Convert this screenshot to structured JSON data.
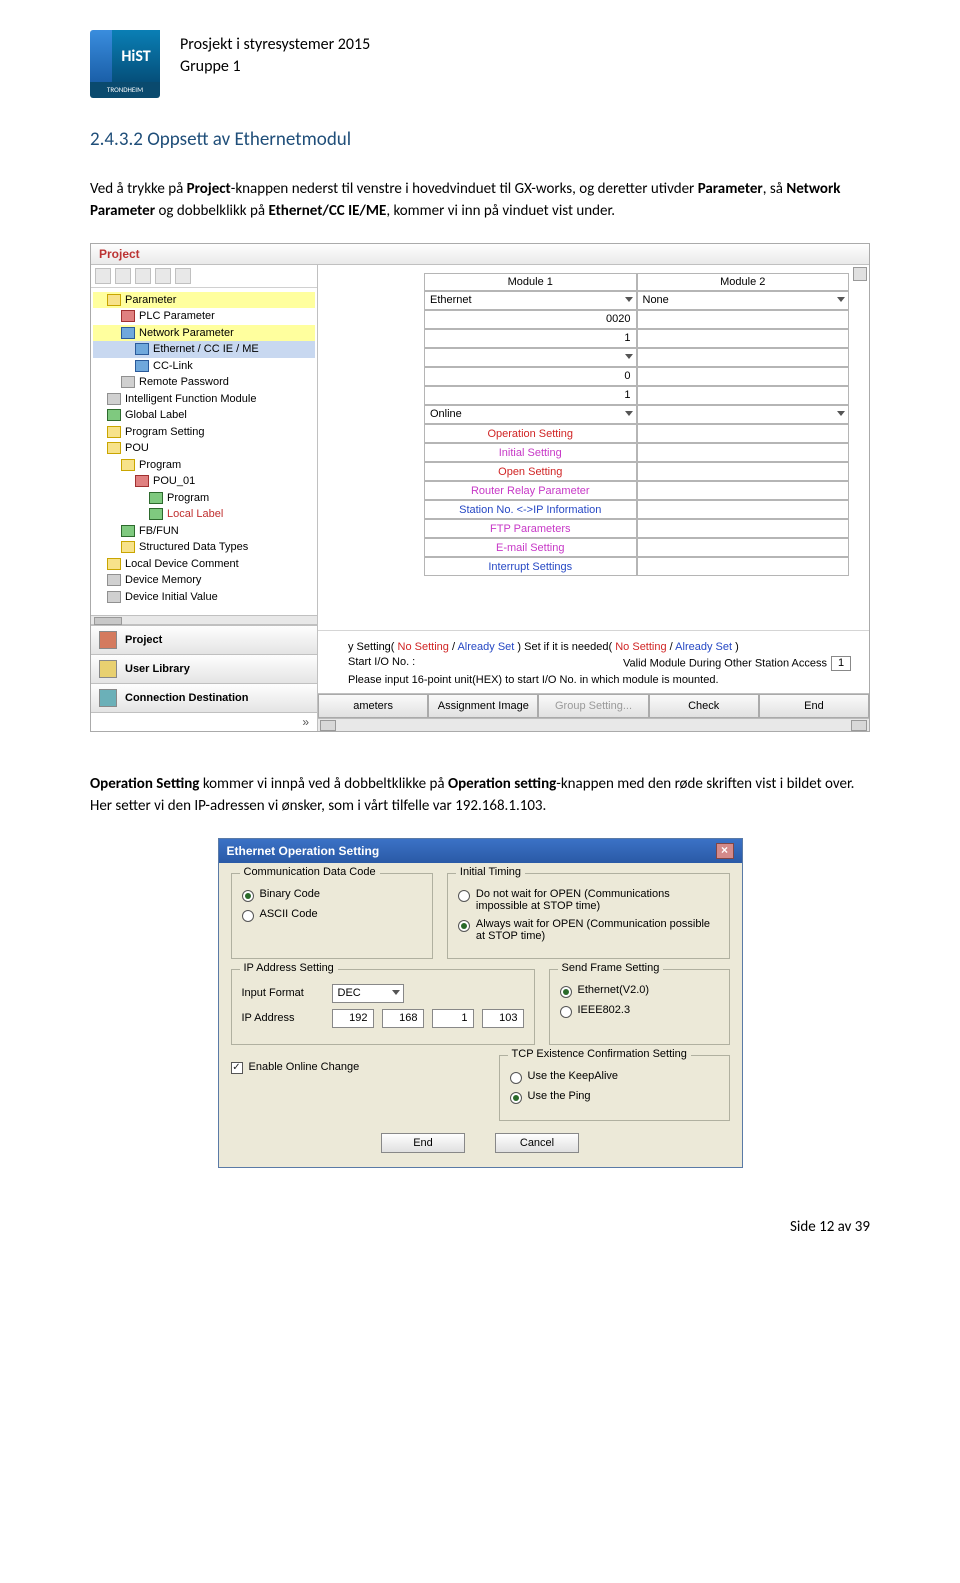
{
  "header": {
    "title_line1": "Prosjekt i styresystemer 2015",
    "title_line2": "Gruppe 1",
    "logo_text": "HiST",
    "logo_sub": "TRONDHEIM"
  },
  "section_heading": "2.4.3.2 Oppsett av Ethernetmodul",
  "para1_pre": "Ved å trykke på ",
  "para1_b1": "Project",
  "para1_mid1": "-knappen nederst til venstre i hovedvinduet til GX-works, og deretter utivder ",
  "para1_b2": "Parameter",
  "para1_mid2": ", så ",
  "para1_b3": "Network Parameter",
  "para1_mid3": " og dobbelklikk på ",
  "para1_b4": "Ethernet/CC IE/ME",
  "para1_mid4": ", kommer vi inn på vinduet vist under.",
  "para2_b1": "Operation Setting",
  "para2_mid1": " kommer vi innpå ved å dobbeltklikke på ",
  "para2_b2": "Operation setting",
  "para2_mid2": "-knappen med den røde skriften vist i bildet over. Her setter vi den IP-adressen vi ønsker, som i vårt tilfelle var 192.168.1.103.",
  "footer_text": "Side 12 av 39",
  "s1": {
    "project_label": "Project",
    "tree": {
      "parameter": "Parameter",
      "plc_parameter": "PLC Parameter",
      "network_parameter": "Network Parameter",
      "ethernet_cc": "Ethernet / CC IE / ME",
      "cc_link": "CC-Link",
      "remote_password": "Remote Password",
      "intelligent_module": "Intelligent Function Module",
      "global_label": "Global Label",
      "program_setting": "Program Setting",
      "pou": "POU",
      "program": "Program",
      "pou01": "POU_01",
      "program2": "Program",
      "local_label": "Local Label",
      "fbfun": "FB/FUN",
      "struct_types": "Structured Data Types",
      "local_dev_comment": "Local Device Comment",
      "device_memory": "Device Memory",
      "device_initial": "Device Initial Value"
    },
    "nav": {
      "project": "Project",
      "user_library": "User Library",
      "conn_dest": "Connection Destination"
    },
    "mod": {
      "h1": "Module 1",
      "h2": "Module 2",
      "ethernet": "Ethernet",
      "none": "None",
      "val_0020": "0020",
      "val_1": "1",
      "val_0": "0",
      "online": "Online"
    },
    "links": {
      "op_setting": "Operation Setting",
      "initial_setting": "Initial Setting",
      "open_setting": "Open Setting",
      "router_relay": "Router Relay Parameter",
      "station_ip": "Station No. <->IP Information",
      "ftp": "FTP Parameters",
      "email": "E-mail Setting",
      "interrupt": "Interrupt Settings"
    },
    "status": {
      "line1_pre": "y Setting( ",
      "no_setting": "No Setting",
      "slash": "  /  ",
      "already_set": "Already Set",
      "line1_post": " )          Set if it is needed( ",
      "line1_end": " )",
      "line2": "Start I/O No. :",
      "line2_right": "Valid Module During Other Station Access",
      "valid_val": "1",
      "line3": "Please input 16-point unit(HEX) to start I/O No. in which module is mounted."
    },
    "buttons": {
      "b1": "ameters",
      "b2": "Assignment Image",
      "b3": "Group Setting...",
      "b4": "Check",
      "b5": "End"
    }
  },
  "s2": {
    "title": "Ethernet Operation Setting",
    "comm_code_label": "Communication Data Code",
    "binary": "Binary Code",
    "ascii": "ASCII Code",
    "initial_timing_label": "Initial Timing",
    "timing_opt1": "Do not wait for OPEN (Communications impossible at STOP time)",
    "timing_opt2": "Always wait for OPEN (Communication possible at STOP time)",
    "ip_setting_label": "IP Address Setting",
    "input_format": "Input Format",
    "dec": "DEC",
    "ip_address_label": "IP Address",
    "ip": {
      "a": "192",
      "b": "168",
      "c": "1",
      "d": "103"
    },
    "send_frame_label": "Send Frame Setting",
    "eth_v2": "Ethernet(V2.0)",
    "ieee": "IEEE802.3",
    "enable_online": "Enable Online Change",
    "tcp_label": "TCP Existence Confirmation Setting",
    "keepalive": "Use the KeepAlive",
    "use_ping": "Use the Ping",
    "btn_end": "End",
    "btn_cancel": "Cancel"
  }
}
